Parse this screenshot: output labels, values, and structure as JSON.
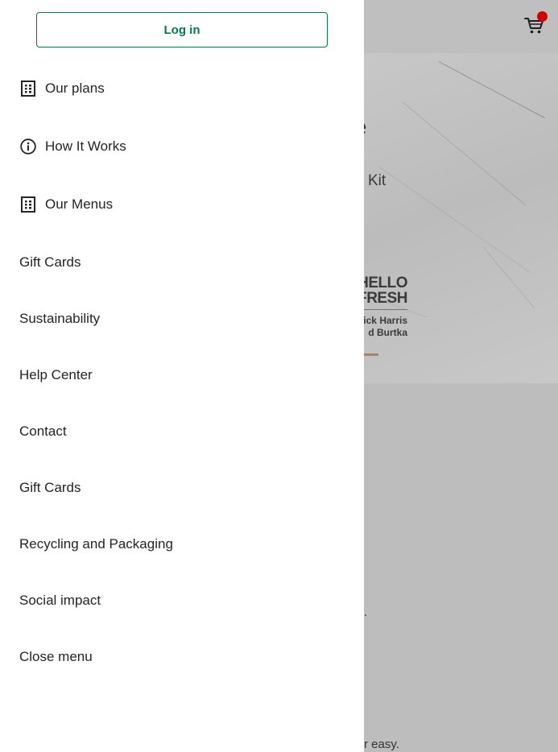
{
  "background": {
    "hero_fragment_heading": "e",
    "hero_fragment_kit": "Kit",
    "book": {
      "line1": "HELLO",
      "line2": "FRESH",
      "author1": "ick Harris",
      "author2": "d Burtka"
    },
    "fragment_period": ".",
    "fragment_easy": "r easy."
  },
  "colors": {
    "accent": "#067a46",
    "cart_badge": "#d40000"
  },
  "drawer": {
    "login_label": "Log in",
    "menu": [
      {
        "label": "Our plans",
        "icon": "plans-list-icon"
      },
      {
        "label": "How It Works",
        "icon": "info-icon"
      },
      {
        "label": "Our Menus",
        "icon": "menus-list-icon"
      },
      {
        "label": "Gift Cards"
      },
      {
        "label": "Sustainability"
      },
      {
        "label": "Help Center"
      },
      {
        "label": "Contact"
      },
      {
        "label": "Gift Cards"
      },
      {
        "label": "Recycling and Packaging"
      },
      {
        "label": "Social impact"
      },
      {
        "label": "Close menu"
      }
    ]
  }
}
